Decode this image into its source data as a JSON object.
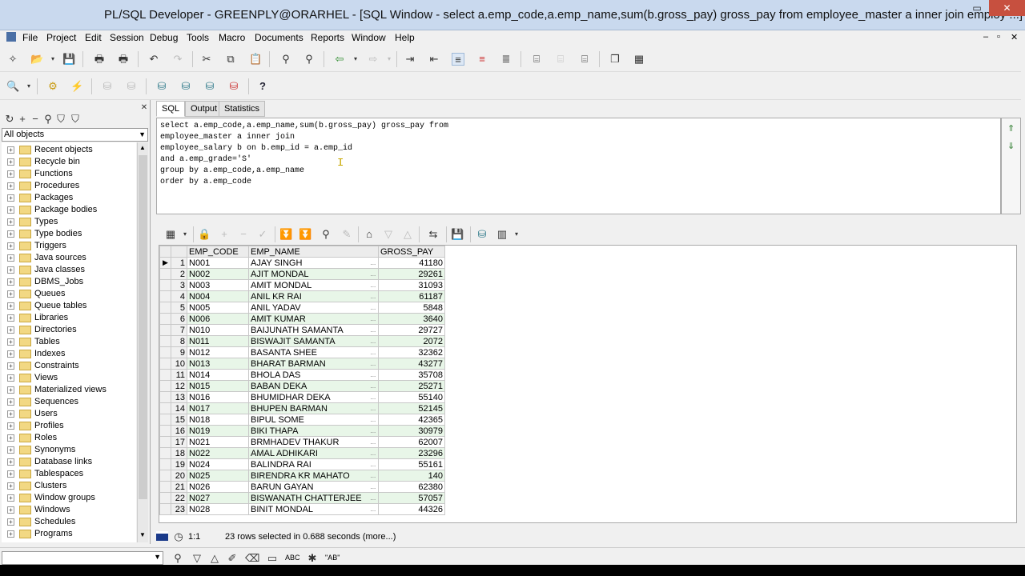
{
  "window": {
    "title": "PL/SQL Developer - GREENPLY@ORARHEL - [SQL Window - select a.emp_code,a.emp_name,sum(b.gross_pay) gross_pay from employee_master a inner join employ ...]"
  },
  "menu": [
    "File",
    "Project",
    "Edit",
    "Session",
    "Debug",
    "Tools",
    "Macro",
    "Documents",
    "Reports",
    "Window",
    "Help"
  ],
  "sidebar": {
    "filter": "All objects",
    "items": [
      "Recent objects",
      "Recycle bin",
      "Functions",
      "Procedures",
      "Packages",
      "Package bodies",
      "Types",
      "Type bodies",
      "Triggers",
      "Java sources",
      "Java classes",
      "DBMS_Jobs",
      "Queues",
      "Queue tables",
      "Libraries",
      "Directories",
      "Tables",
      "Indexes",
      "Constraints",
      "Views",
      "Materialized views",
      "Sequences",
      "Users",
      "Profiles",
      "Roles",
      "Synonyms",
      "Database links",
      "Tablespaces",
      "Clusters",
      "Window groups",
      "Windows",
      "Schedules",
      "Programs"
    ]
  },
  "tabs": [
    "SQL",
    "Output",
    "Statistics"
  ],
  "editor": {
    "lines": [
      "select a.emp_code,a.emp_name,sum(b.gross_pay) gross_pay from",
      "employee_master a inner join",
      "employee_salary b on b.emp_id = a.emp_id",
      "and a.emp_grade='S'",
      "group by a.emp_code,a.emp_name",
      "order by a.emp_code"
    ]
  },
  "grid": {
    "columns": [
      "EMP_CODE",
      "EMP_NAME",
      "GROSS_PAY"
    ],
    "ellipsis": "...",
    "rows": [
      [
        "1",
        "N001",
        "AJAY  SINGH",
        "41180"
      ],
      [
        "2",
        "N002",
        "AJIT MONDAL",
        "29261"
      ],
      [
        "3",
        "N003",
        "AMIT MONDAL",
        "31093"
      ],
      [
        "4",
        "N004",
        "ANIL KR RAI",
        "61187"
      ],
      [
        "5",
        "N005",
        "ANIL YADAV",
        "5848"
      ],
      [
        "6",
        "N006",
        "AMIT KUMAR",
        "3640"
      ],
      [
        "7",
        "N010",
        "BAIJUNATH SAMANTA",
        "29727"
      ],
      [
        "8",
        "N011",
        "BISWAJIT SAMANTA",
        "2072"
      ],
      [
        "9",
        "N012",
        "BASANTA SHEE",
        "32362"
      ],
      [
        "10",
        "N013",
        "BHARAT BARMAN",
        "43277"
      ],
      [
        "11",
        "N014",
        "BHOLA DAS",
        "35708"
      ],
      [
        "12",
        "N015",
        "BABAN DEKA",
        "25271"
      ],
      [
        "13",
        "N016",
        "BHUMIDHAR DEKA",
        "55140"
      ],
      [
        "14",
        "N017",
        "BHUPEN BARMAN",
        "52145"
      ],
      [
        "15",
        "N018",
        "BIPUL SOME",
        "42365"
      ],
      [
        "16",
        "N019",
        "BIKI THAPA",
        "30979"
      ],
      [
        "17",
        "N021",
        "BRMHADEV THAKUR",
        "62007"
      ],
      [
        "18",
        "N022",
        "AMAL ADHIKARI",
        "23296"
      ],
      [
        "19",
        "N024",
        "BALINDRA RAI",
        "55161"
      ],
      [
        "20",
        "N025",
        "BIRENDRA KR MAHATO",
        "140"
      ],
      [
        "21",
        "N026",
        "BARUN GAYAN",
        "62380"
      ],
      [
        "22",
        "N027",
        "BISWANATH CHATTERJEE",
        "57057"
      ],
      [
        "23",
        "N028",
        "BINIT MONDAL",
        "44326"
      ]
    ]
  },
  "status": {
    "position": "1:1",
    "message": "23 rows selected in 0.688 seconds (more...)"
  },
  "bottom": {
    "abc_label": "ABC",
    "ab_label": "\"AB\""
  }
}
